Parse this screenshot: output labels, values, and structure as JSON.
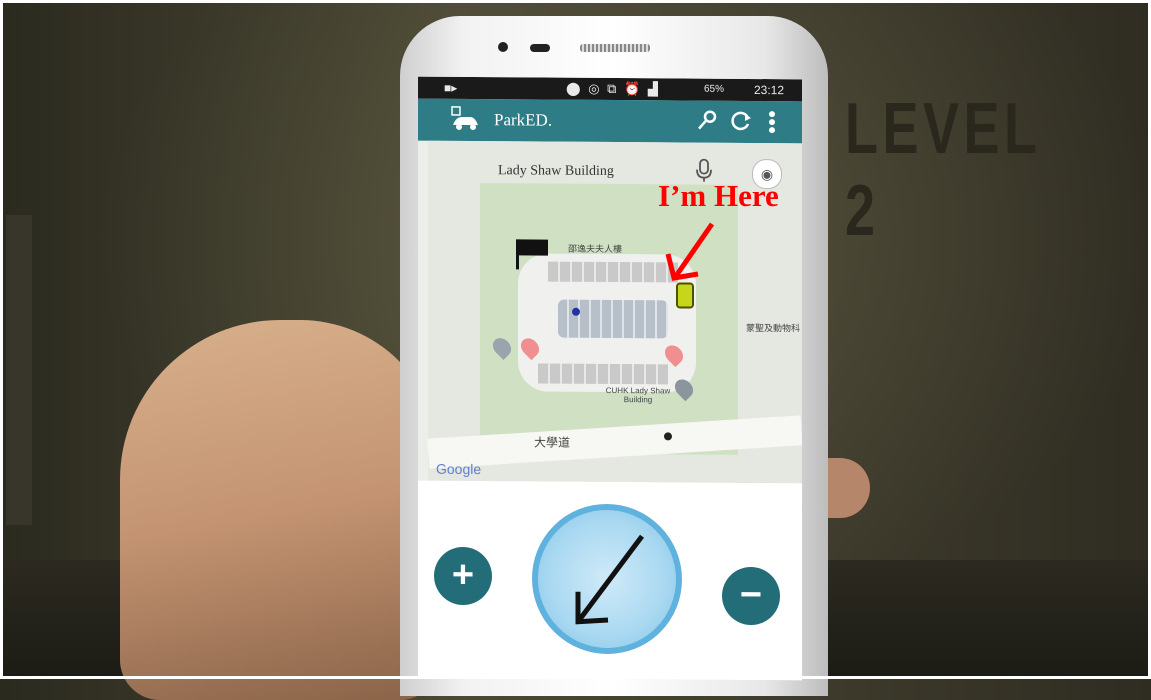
{
  "scene": {
    "wall_sign": "LEVEL 2",
    "annotation": "I’m Here"
  },
  "statusbar": {
    "battery": "65%",
    "time": "23:12"
  },
  "app": {
    "title": "ParkED."
  },
  "map": {
    "building_name": "Lady Shaw Building",
    "map_label_top": "邵逸夫夫人樓",
    "map_label_right": "蒙聖及動物科",
    "map_label_bottom": "CUHK Lady Shaw Building",
    "road_label": "大學道",
    "attribution": "Google"
  },
  "controls": {
    "zoom_in": "+",
    "zoom_out": "−"
  },
  "colors": {
    "appbar": "#2e7d86",
    "zoom_buttons": "#236d79",
    "compass_ring": "#5fb2dd",
    "annotation": "#ff0000"
  }
}
